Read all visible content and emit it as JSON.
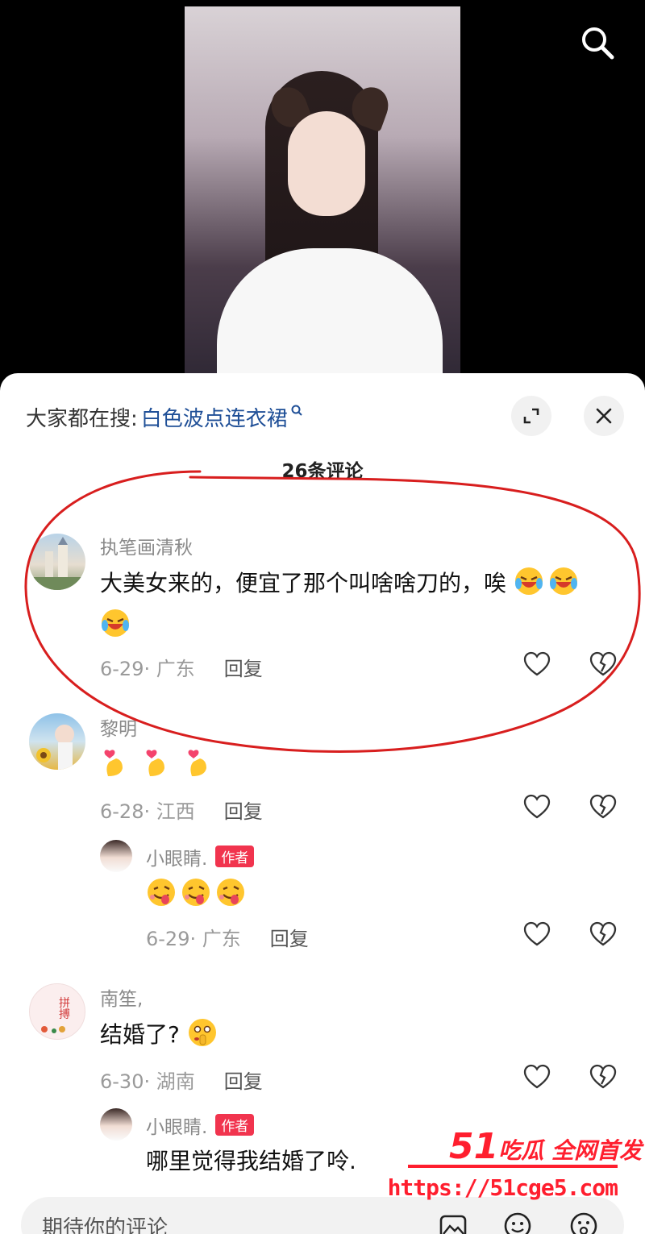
{
  "search_bar": {
    "prefix": "大家都在搜:",
    "term": "白色波点连衣裙"
  },
  "comment_count": "26条评论",
  "comments": [
    {
      "user": "执笔画清秋",
      "text": "大美女来的，便宜了那个叫啥啥刀的，唉",
      "emojis": [
        "laughing-crying-emoji",
        "laughing-crying-emoji",
        "laughing-crying-emoji"
      ],
      "date_location": "6-29· 广东",
      "reply": "回复"
    },
    {
      "user": "黎明",
      "text": "",
      "emojis": [
        "finger-heart-emoji",
        "finger-heart-emoji",
        "finger-heart-emoji"
      ],
      "date_location": "6-28· 江西",
      "reply": "回复",
      "replies": [
        {
          "user": "小眼睛.",
          "badge": "作者",
          "text": "",
          "emojis": [
            "tongue-wink-emoji",
            "tongue-wink-emoji",
            "tongue-wink-emoji"
          ],
          "date_location": "6-29· 广东",
          "reply": "回复"
        }
      ]
    },
    {
      "user": "南笙,",
      "text": "结婚了?",
      "emojis": [
        "shushing-face-emoji"
      ],
      "date_location": "6-30· 湖南",
      "reply": "回复",
      "replies": [
        {
          "user": "小眼睛.",
          "badge": "作者",
          "text": "哪里觉得我结婚了呤."
        }
      ]
    }
  ],
  "input": {
    "placeholder": "期待你的评论"
  },
  "watermark": {
    "brand_num": "51",
    "brand_text": "吃瓜 全网首发",
    "url": "https://51cge5.com"
  },
  "colors": {
    "search_link": "#1f4f97",
    "author_badge": "#f1344e",
    "annotation": "#d81e1e",
    "watermark": "#ff1e2e"
  }
}
